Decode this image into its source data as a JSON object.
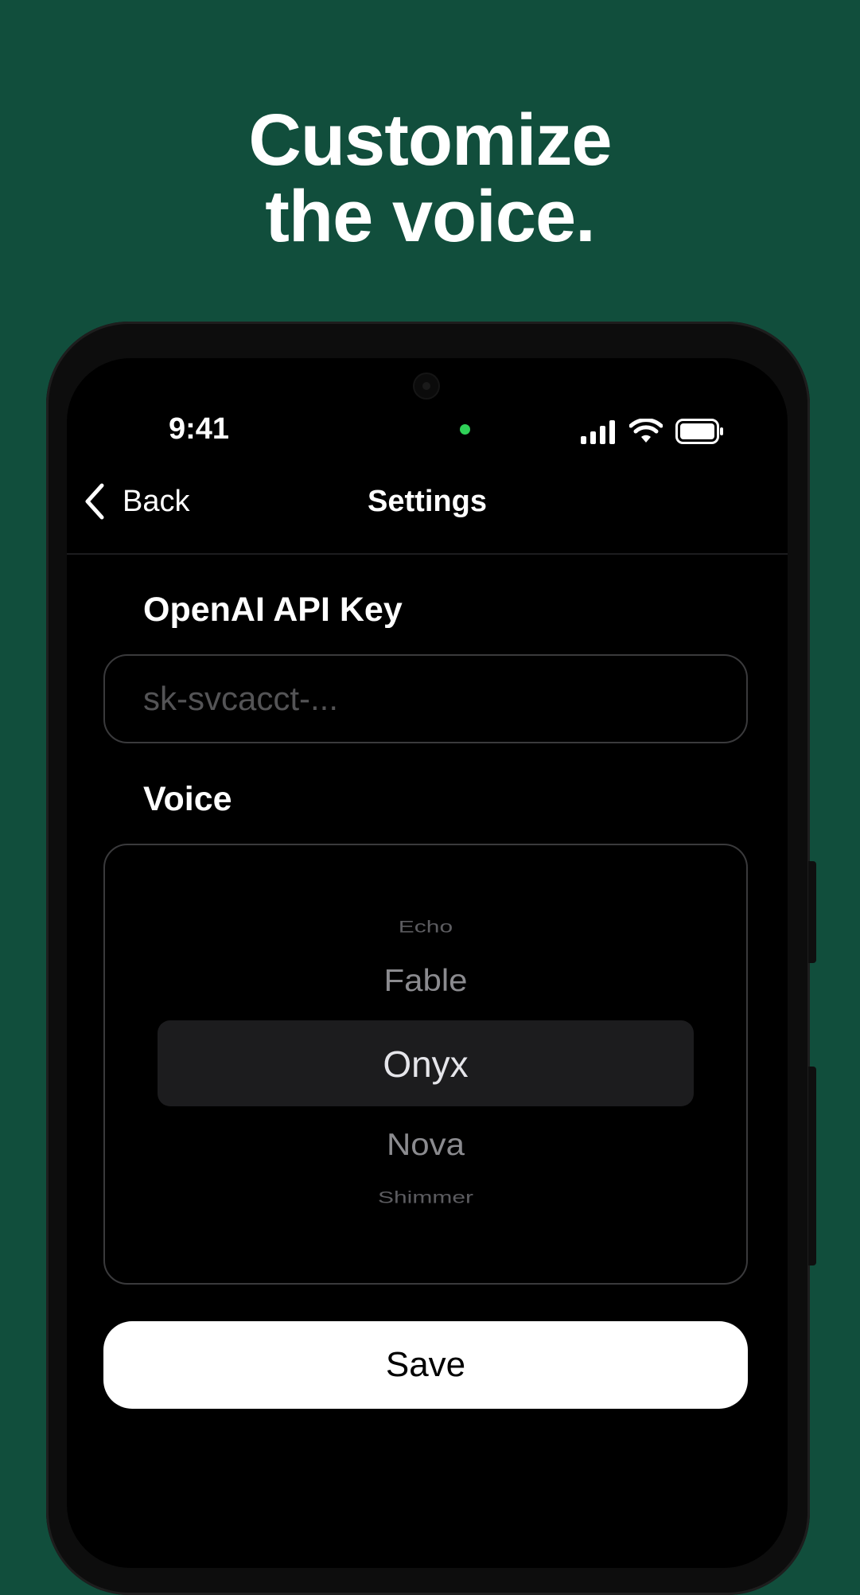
{
  "headline": {
    "line1": "Customize",
    "line2": "the voice."
  },
  "status_bar": {
    "time": "9:41",
    "icons": [
      "signal-icon",
      "wifi-icon",
      "battery-icon"
    ],
    "indicator_color": "#2fd158"
  },
  "nav": {
    "back_label": "Back",
    "back_icon": "chevron-left-icon",
    "title": "Settings"
  },
  "api_key": {
    "label": "OpenAI API Key",
    "placeholder": "sk-svcacct-...",
    "value": ""
  },
  "voice": {
    "label": "Voice",
    "options": [
      "Echo",
      "Fable",
      "Onyx",
      "Nova",
      "Shimmer"
    ],
    "selected": "Onyx"
  },
  "save_label": "Save",
  "colors": {
    "background": "#114e3c",
    "screen": "#000000",
    "button": "#ffffff"
  }
}
